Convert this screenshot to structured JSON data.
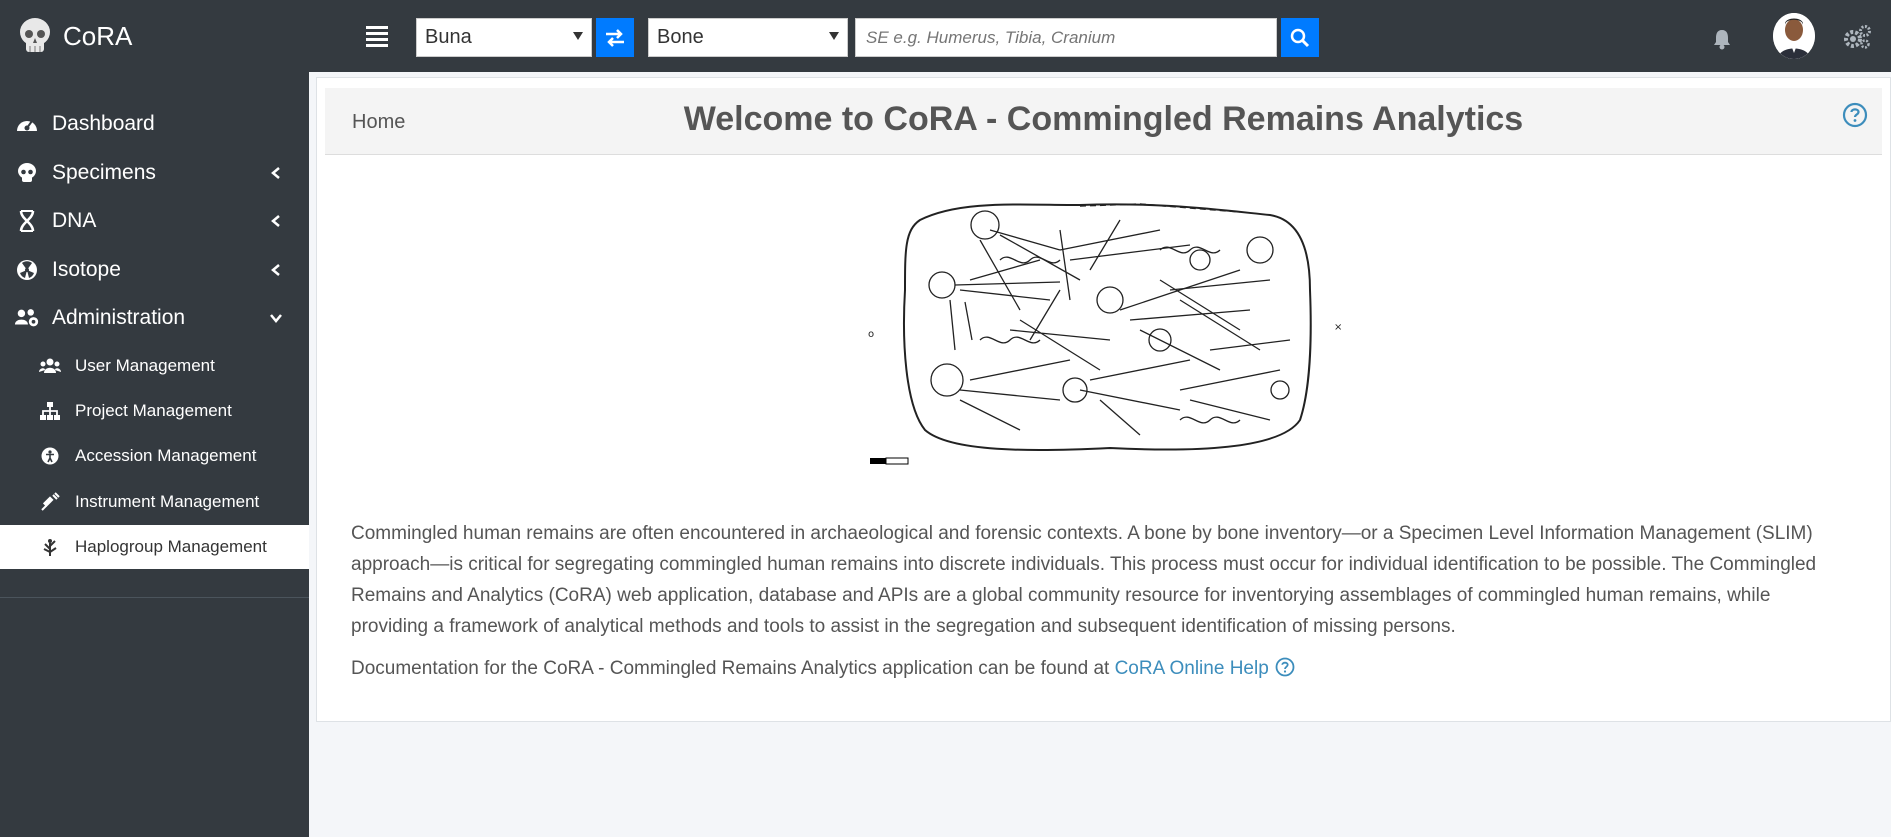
{
  "app": {
    "name": "CoRA"
  },
  "topbar": {
    "project_select": "Buna",
    "type_select": "Bone",
    "search_placeholder": "SE e.g. Humerus, Tibia, Cranium",
    "icons": [
      "skull-logo",
      "bars-icon",
      "exchange-icon",
      "search-icon",
      "bell-icon",
      "user-avatar",
      "cogs-icon"
    ]
  },
  "sidebar": {
    "items": [
      {
        "label": "Dashboard",
        "icon": "tachometer-icon"
      },
      {
        "label": "Specimens",
        "icon": "skull-icon"
      },
      {
        "label": "DNA",
        "icon": "dna-icon"
      },
      {
        "label": "Isotope",
        "icon": "radiation-icon"
      },
      {
        "label": "Administration",
        "icon": "users-cog-icon"
      }
    ],
    "sub_items": [
      {
        "label": "User Management",
        "icon": "users-icon"
      },
      {
        "label": "Project Management",
        "icon": "sitemap-icon"
      },
      {
        "label": "Accession Management",
        "icon": "accession-icon"
      },
      {
        "label": "Instrument Management",
        "icon": "syringe-icon"
      },
      {
        "label": "Haplogroup Management",
        "icon": "haplogroup-icon"
      }
    ]
  },
  "main": {
    "breadcrumb": "Home",
    "title": "Welcome to CoRA - Commingled Remains Analytics",
    "description": "Commingled human remains are often encountered in archaeological and forensic contexts. A bone by bone inventory—or a Specimen Level Information Management (SLIM) approach—is critical for segregating commingled human remains into discrete individuals. This process must occur for individual identification to be possible. The Commingled Remains and Analytics (CoRA) web application, database and APIs are a global community resource for inventorying assemblages of commingled human remains, while providing a framework of analytical methods and tools to assist in the segregation and subsequent identification of missing persons.",
    "doc_prefix": "Documentation for the CoRA - Commingled Remains Analytics application can be found at ",
    "doc_link": "CoRA Online Help"
  },
  "colors": {
    "navbar": "#343a40",
    "accent": "#007bff",
    "link": "#3c8dbc"
  }
}
